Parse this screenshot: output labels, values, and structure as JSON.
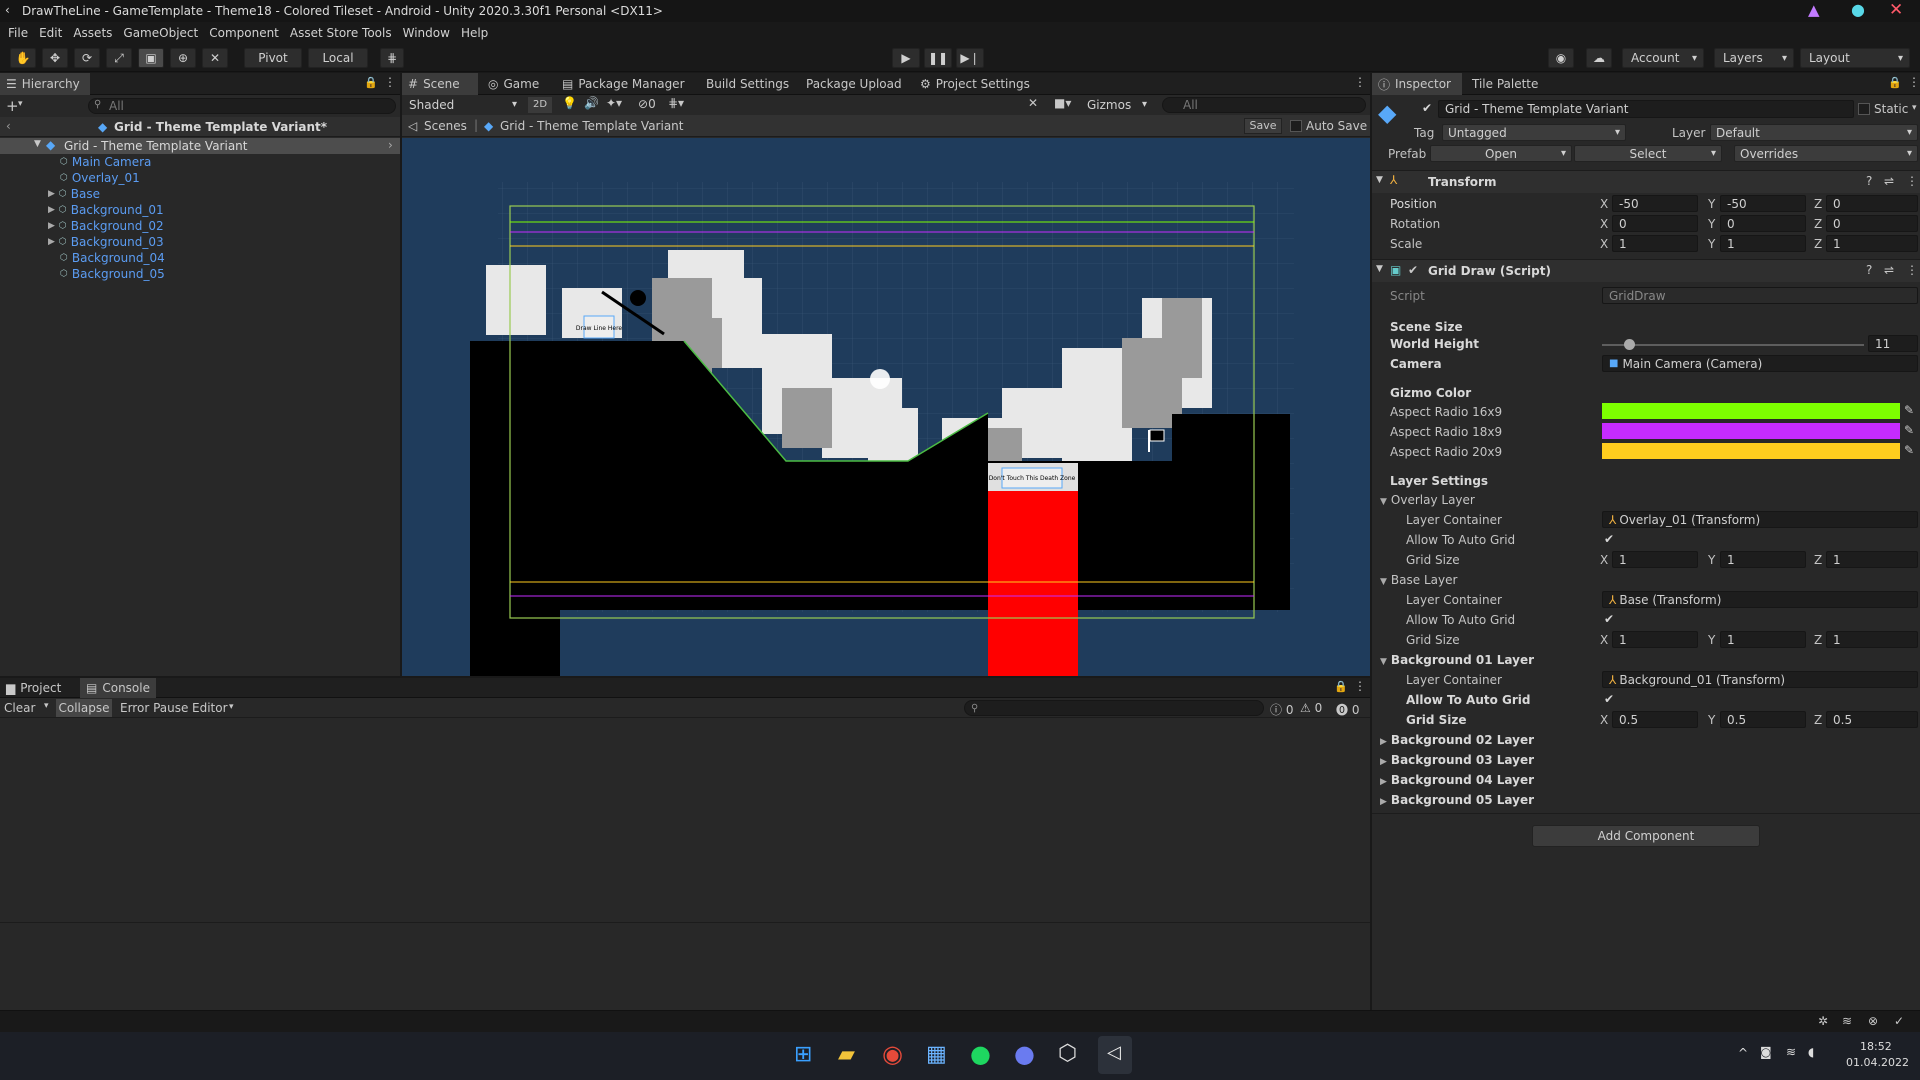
{
  "window": {
    "title": "DrawTheLine - GameTemplate - Theme18 - Colored Tileset - Android - Unity 2020.3.30f1 Personal <DX11>"
  },
  "menu": [
    "File",
    "Edit",
    "Assets",
    "GameObject",
    "Component",
    "Asset Store Tools",
    "Window",
    "Help"
  ],
  "toolbar": {
    "pivot": "Pivot",
    "local": "Local",
    "account": "Account",
    "layers": "Layers",
    "layout": "Layout"
  },
  "hierarchy": {
    "tab": "Hierarchy",
    "search_placeholder": "All",
    "scene": "Grid - Theme Template Variant*",
    "root": "Grid - Theme Template Variant",
    "items": [
      "Main Camera",
      "Overlay_01",
      "Base",
      "Background_01",
      "Background_02",
      "Background_03",
      "Background_04",
      "Background_05"
    ]
  },
  "center_tabs": [
    "Scene",
    "Game",
    "Package Manager",
    "Build Settings",
    "Package Upload",
    "Project Settings"
  ],
  "scene_toolbar": {
    "shading": "Shaded",
    "mode2d": "2D",
    "fx_count": "0",
    "gizmos": "Gizmos",
    "search_placeholder": "All"
  },
  "breadcrumb": {
    "scenes": "Scenes",
    "prefab": "Grid - Theme Template Variant",
    "save": "Save",
    "autosave": "Auto Save"
  },
  "scene_signs": {
    "sign1": "Draw Line Here",
    "sign2": "Don't Touch This Death Zone"
  },
  "bottom_tabs": [
    "Project",
    "Console"
  ],
  "console": {
    "clear": "Clear",
    "collapse": "Collapse",
    "error_pause": "Error Pause",
    "editor": "Editor",
    "count_log": "0",
    "count_warn": "0",
    "count_err": "0"
  },
  "inspector": {
    "tabs": [
      "Inspector",
      "Tile Palette"
    ],
    "object_name": "Grid - Theme Template Variant",
    "static": "Static",
    "tag_label": "Tag",
    "tag_value": "Untagged",
    "layer_label": "Layer",
    "layer_value": "Default",
    "prefab_label": "Prefab",
    "open": "Open",
    "select": "Select",
    "overrides": "Overrides",
    "transform": {
      "title": "Transform",
      "position": {
        "label": "Position",
        "x": "-50",
        "y": "-50",
        "z": "0"
      },
      "rotation": {
        "label": "Rotation",
        "x": "0",
        "y": "0",
        "z": "0"
      },
      "scale": {
        "label": "Scale",
        "x": "1",
        "y": "1",
        "z": "1"
      }
    },
    "griddraw": {
      "title": "Grid Draw (Script)",
      "script_label": "Script",
      "script_value": "GridDraw",
      "scene_size": "Scene Size",
      "world_height_label": "World Height",
      "world_height": "11",
      "world_height_fraction": 0.1,
      "camera_label": "Camera",
      "camera_value": "Main Camera (Camera)",
      "gizmo_color": "Gizmo Color",
      "colors": [
        {
          "label": "Aspect Radio 16x9",
          "hex": "#7dff00"
        },
        {
          "label": "Aspect Radio 18x9",
          "hex": "#c52bff"
        },
        {
          "label": "Aspect Radio 20x9",
          "hex": "#ffcd1e"
        }
      ],
      "layer_settings": "Layer Settings",
      "layers": [
        {
          "name": "Overlay Layer",
          "container": "Overlay_01 (Transform)",
          "grid": {
            "x": "1",
            "y": "1",
            "z": "1"
          }
        },
        {
          "name": "Base Layer",
          "container": "Base (Transform)",
          "grid": {
            "x": "1",
            "y": "1",
            "z": "1"
          }
        },
        {
          "name": "Background 01 Layer",
          "container": "Background_01 (Transform)",
          "grid": {
            "x": "0.5",
            "y": "0.5",
            "z": "0.5"
          }
        }
      ],
      "layer_container_label": "Layer Container",
      "auto_grid_label": "Allow To Auto Grid",
      "grid_size_label": "Grid Size",
      "collapsed_layers": [
        "Background 02 Layer",
        "Background 03 Layer",
        "Background 04 Layer",
        "Background 05 Layer"
      ]
    },
    "add_component": "Add Component"
  },
  "taskbar": {
    "time": "18:52",
    "date": "01.04.2022"
  },
  "colors": {
    "accent_blue": "#5b9cf2",
    "death_zone": "#ff0000"
  }
}
